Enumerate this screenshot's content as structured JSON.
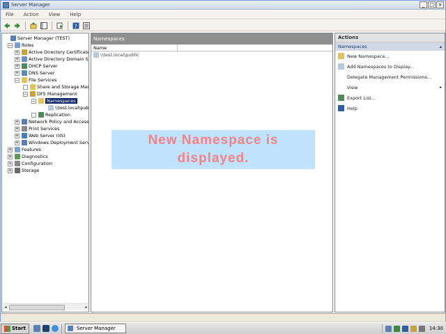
{
  "window": {
    "title": "Server Manager",
    "min_label": "_",
    "max_label": "□",
    "close_label": "×"
  },
  "menu": [
    "File",
    "Action",
    "View",
    "Help"
  ],
  "tree": {
    "root": "Server Manager (TEST)",
    "roles": "Roles",
    "ad_cs": "Active Directory Certificate",
    "ad_ds": "Active Directory Domain Se",
    "dhcp": "DHCP Server",
    "dns": "DNS Server",
    "file_services": "File Services",
    "share_storage": "Share and Storage Mar",
    "dfs_management": "DFS Management",
    "namespaces": "Namespaces",
    "namespace_item": "\\\\test.local\\pub",
    "replication": "Replication",
    "npas": "Network Policy and Access",
    "print": "Print Services",
    "web": "Web Server (IIS)",
    "wds": "Windows Deployment Servi",
    "features": "Features",
    "diagnostics": "Diagnostics",
    "configuration": "Configuration",
    "storage": "Storage"
  },
  "center": {
    "header": "Namespaces",
    "column_name": "Name",
    "rows": [
      "\\\\test.local\\public"
    ]
  },
  "callout": {
    "line1": "New Namespace is",
    "line2": "displayed."
  },
  "actions": {
    "header": "Actions",
    "section": "Namespaces",
    "items": {
      "new_namespace": "New Namespace...",
      "add_to_display": "Add Namespaces to Display...",
      "delegate": "Delegate Management Permissions...",
      "view": "View",
      "export": "Export List...",
      "help": "Help"
    }
  },
  "taskbar": {
    "start": "Start",
    "task": "Server Manager",
    "clock": "14:30"
  },
  "colors": {
    "selection": "#0a246a",
    "callout_bg": "#bfe2ff",
    "callout_text": "#f28484"
  }
}
